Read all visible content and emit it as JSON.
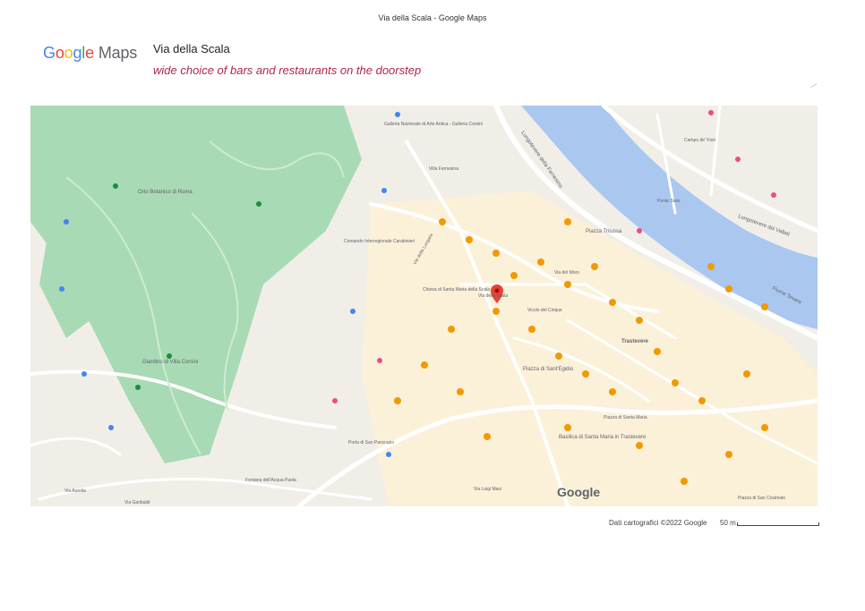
{
  "page": {
    "header_title": "Via della Scala - Google Maps"
  },
  "brand": {
    "logo_text": "Google Maps"
  },
  "place": {
    "title": "Via della Scala",
    "description": "wide choice of bars and restaurants on the doorstep"
  },
  "map": {
    "watermark": "Google",
    "attribution": "Dati cartografici ©2022 Google",
    "scale_label": "50 m",
    "colors": {
      "park": "#a8dab5",
      "river": "#aac7f0",
      "roads": "#ffffff",
      "poi": "#f29900",
      "pin": "#ea4335"
    },
    "labels": {
      "orto_botanico": "Orto Botanico di Roma",
      "giardino": "Giardino di Villa Corsini",
      "fiume": "Fiume Tevere",
      "lungotevere_farnesina": "Lungotevere della Farnesina",
      "lungotevere_vallati": "Lungotevere dei Vallati",
      "via_della_scala": "Via della Scala",
      "piazza_trilussa": "Piazza Trilussa",
      "santa_maria_scala": "Chiesa di Santa Maria della Scala",
      "piazza_sant_egidio": "Piazza di Sant'Egidio",
      "santa_maria_trastevere": "Basilica di Santa Maria in Trastevere",
      "galleria_corsini": "Galleria Nazionale di Arte Antica - Galleria Corsini",
      "ponte_sisto": "Ponte Sisto",
      "piazza_santa_maria": "Piazza di Santa Maria",
      "campo_de_fiori": "Campo de' Fiori",
      "via_garibaldi": "Via Garibaldi",
      "via_luigi_masi": "Via Luigi Masi",
      "via_aurelia": "Via Aurelia",
      "porta_san_pancrazio": "Porta di San Pancrazio",
      "fontana_acqua_paola": "Fontana dell'Acqua Paola",
      "carabinieri": "Comando Interregionale Carabinieri",
      "villa_farnesina": "Villa Farnesina",
      "vicolo_del_cinque": "Vicolo del Cinque",
      "via_del_moro": "Via del Moro",
      "piazza_di_san_cosimato": "Piazza di San Cosimato",
      "via_della_lungara": "Via della Lungara",
      "trastevere": "Trastevere"
    }
  }
}
